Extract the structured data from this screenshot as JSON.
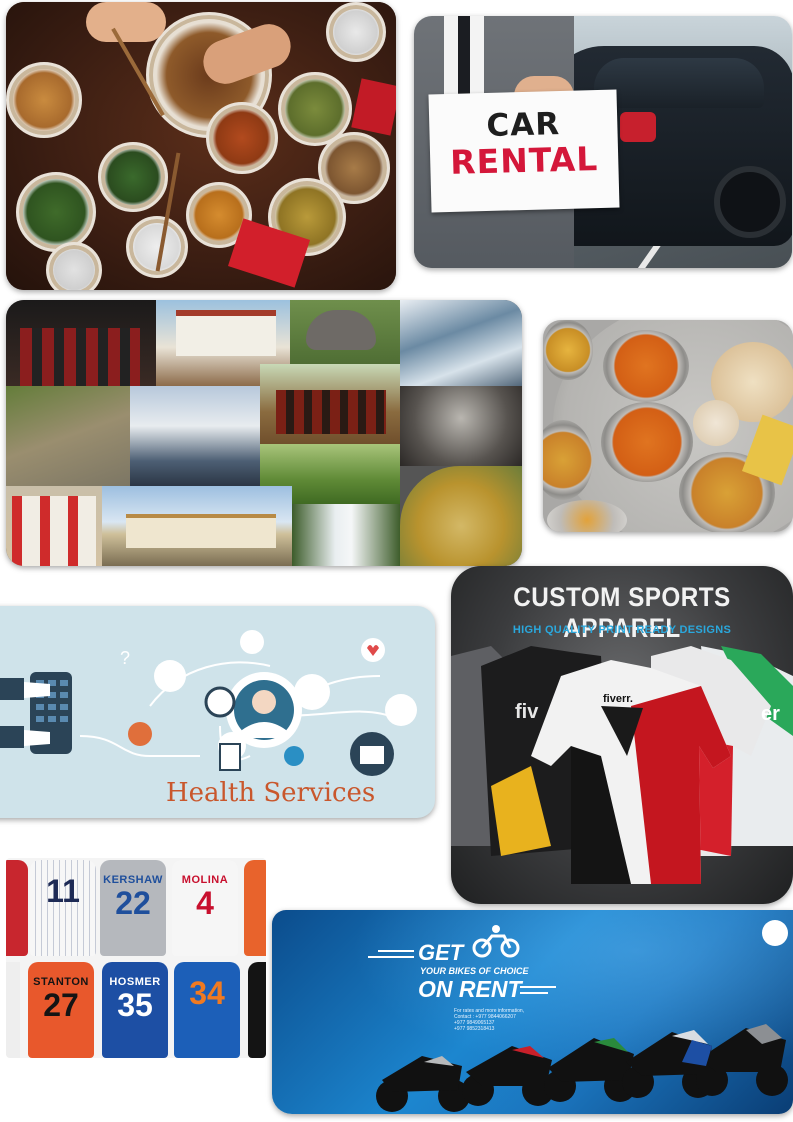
{
  "car_rental": {
    "line1": "CAR",
    "line2": "RENTAL"
  },
  "health": {
    "title": "Health Services"
  },
  "sports": {
    "title": "CUSTOM SPORTS APPAREL",
    "subtitle": "HIGH QUALITY PRINT READY DESIGNS",
    "brand": "fiverr."
  },
  "jerseys": [
    {
      "name": "",
      "number": "11",
      "bg": "#f7f7f7",
      "fg": "#1d2a55"
    },
    {
      "name": "KERSHAW",
      "number": "22",
      "bg": "#b5b8bd",
      "fg": "#1f4f9c"
    },
    {
      "name": "MOLINA",
      "number": "4",
      "bg": "#f6f6f6",
      "fg": "#c8102e"
    },
    {
      "name": "STANTON",
      "number": "27",
      "bg": "#e8582c",
      "fg": "#141414"
    },
    {
      "name": "HOSMER",
      "number": "35",
      "bg": "#1d4fa4",
      "fg": "#ffffff"
    },
    {
      "name": "",
      "number": "34",
      "bg": "#1c5fb8",
      "fg": "#f07a21"
    }
  ],
  "bike_rent": {
    "line1": "GET",
    "line2": "YOUR BIKES OF CHOICE",
    "line3": "ON RENT",
    "info": [
      "For rates and more information,",
      "Contact : +977 9844066207",
      "+977 9849065137",
      "+977 9852318413"
    ]
  },
  "colors": {
    "car_rental_red": "#d4173a",
    "health_title": "#c9572c",
    "sports_subtitle": "#2aa8dd",
    "bike_bg": "#1c86cf"
  }
}
